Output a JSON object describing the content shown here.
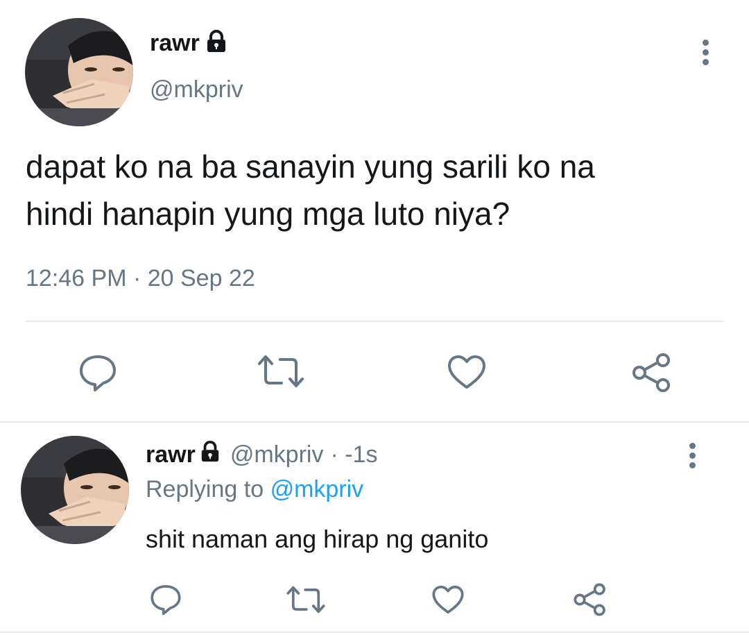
{
  "main_tweet": {
    "display_name": "rawr",
    "handle": "@mkpriv",
    "text_line1": "dapat ko na ba sanayin yung sarili ko na",
    "text_line2": "hindi hanapin yung mga luto niya?",
    "timestamp": "12:46 PM · 20 Sep 22"
  },
  "reply_tweet": {
    "display_name": "rawr",
    "handle": "@mkpriv",
    "time_ago": "· -1s",
    "replying_prefix": "Replying to",
    "replying_handle": "@mkpriv",
    "text": "shit naman ang hirap ng ganito"
  },
  "icons": {
    "reply": "speech-bubble-icon",
    "retweet": "retweet-icon",
    "like": "heart-icon",
    "share": "share-icon",
    "lock": "lock-icon",
    "more": "vertical-dots-icon"
  },
  "colors": {
    "text": "#14171a",
    "secondary": "#657786",
    "link": "#1da1f2",
    "divider": "#e6ecf0"
  }
}
